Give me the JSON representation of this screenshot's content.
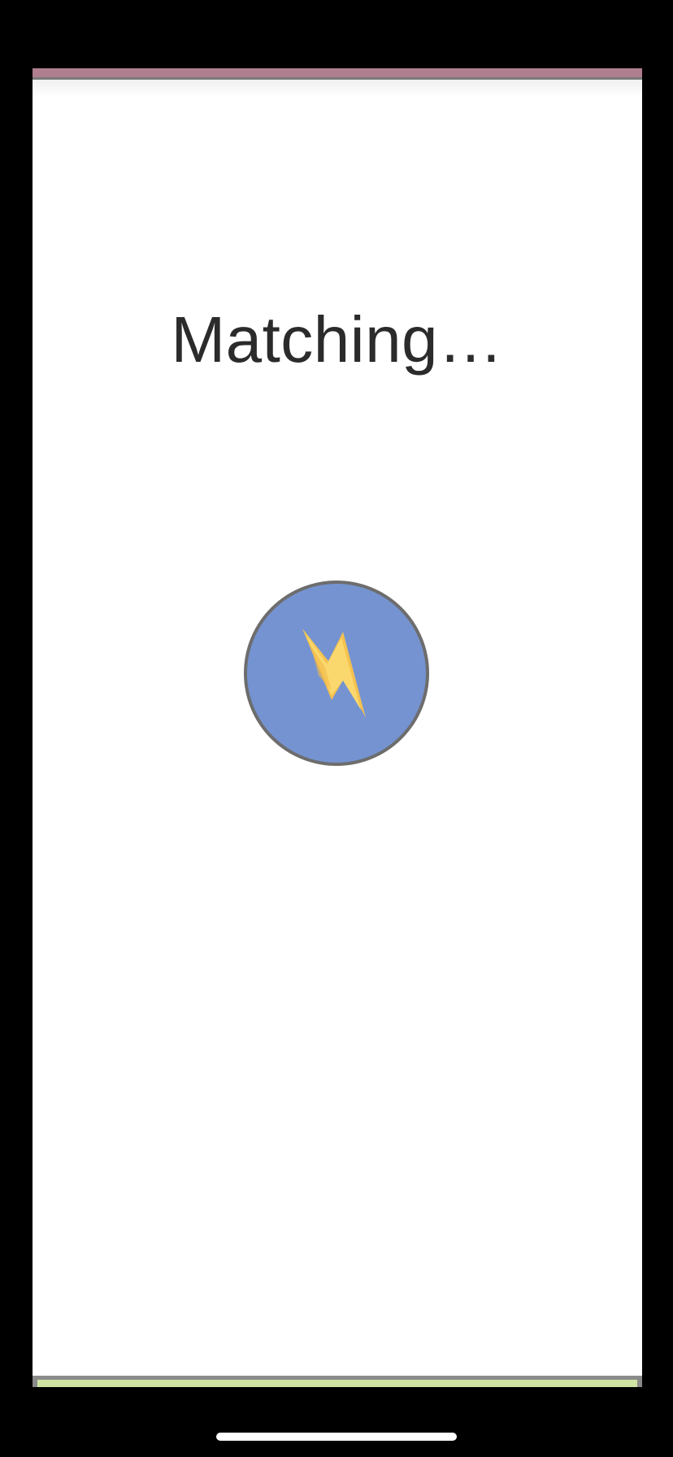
{
  "screen": {
    "title": "Matching…"
  },
  "match_button": {
    "icon": "lightning-bolt-icon"
  },
  "colors": {
    "background": "#000000",
    "panel": "#ffffff",
    "top_bar": "#b07f8f",
    "button_fill": "#7593d1",
    "button_border": "#6d6d6d",
    "bolt": "#f8d568",
    "bottom_bar": "#cfe3a4",
    "title_text": "#2b2b2b"
  }
}
